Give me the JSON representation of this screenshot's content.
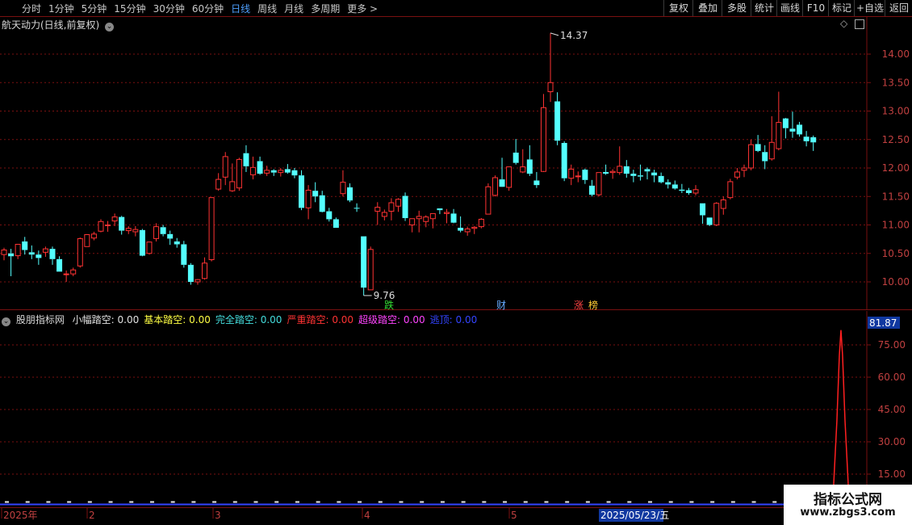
{
  "toolbar": {
    "left_items": [
      "分时",
      "1分钟",
      "5分钟",
      "15分钟",
      "30分钟",
      "60分钟",
      "日线",
      "周线",
      "月线",
      "多周期",
      "更多 >"
    ],
    "active_item": "日线",
    "right_items": [
      "复权",
      "叠加",
      "多股",
      "统计",
      "画线",
      "F10",
      "标记",
      "+自选",
      "返回"
    ]
  },
  "stock_title": "航天动力(日线,前复权)",
  "price_axis": {
    "labels": [
      "14.00",
      "13.50",
      "13.00",
      "12.50",
      "12.00",
      "11.50",
      "11.00",
      "10.50",
      "10.00"
    ]
  },
  "price_markers": {
    "high": "14.37",
    "low": "9.76"
  },
  "event_tags": [
    {
      "text": "跌",
      "color": "#33dd33"
    },
    {
      "text": "财",
      "color": "#66aaff"
    },
    {
      "text": "涨",
      "color": "#ff4444"
    },
    {
      "text": "榜",
      "color": "#ffcc33"
    }
  ],
  "indicator": {
    "name": "股朋指标网",
    "items": [
      {
        "label": "小幅踏空:",
        "value": "0.00",
        "color": "#e0e0e0"
      },
      {
        "label": "基本踏空:",
        "value": "0.00",
        "color": "#ffff44"
      },
      {
        "label": "完全踏空:",
        "value": "0.00",
        "color": "#44dddd"
      },
      {
        "label": "严重踏空:",
        "value": "0.00",
        "color": "#ff3333"
      },
      {
        "label": "超级踏空:",
        "value": "0.00",
        "color": "#ff44ff"
      },
      {
        "label": "逃顶:",
        "value": "0.00",
        "color": "#3344ff"
      }
    ],
    "current_value": "81.87",
    "axis_labels": [
      "75.00",
      "60.00",
      "45.00",
      "30.00",
      "15.00"
    ]
  },
  "date_axis": {
    "labels": [
      "2025年",
      "2",
      "3",
      "4",
      "5"
    ],
    "cursor": "2025/05/23/五"
  },
  "watermark": {
    "line1": "指标公式网",
    "line2": "www.zbgs3.com"
  },
  "colors": {
    "up": "#ff3333",
    "down": "#54ffff",
    "grid": "#7a1010",
    "axis_text": "#c04040"
  },
  "chart_data": {
    "type": "candlestick",
    "price_range": [
      9.5,
      14.6
    ],
    "candles": [
      {
        "o": 10.48,
        "h": 10.6,
        "l": 10.38,
        "c": 10.56
      },
      {
        "o": 10.5,
        "h": 10.58,
        "l": 10.1,
        "c": 10.45
      },
      {
        "o": 10.46,
        "h": 10.66,
        "l": 10.4,
        "c": 10.66
      },
      {
        "o": 10.71,
        "h": 10.79,
        "l": 10.48,
        "c": 10.56
      },
      {
        "o": 10.52,
        "h": 10.64,
        "l": 10.4,
        "c": 10.48
      },
      {
        "o": 10.48,
        "h": 10.55,
        "l": 10.3,
        "c": 10.42
      },
      {
        "o": 10.52,
        "h": 10.62,
        "l": 10.44,
        "c": 10.58
      },
      {
        "o": 10.58,
        "h": 10.62,
        "l": 10.3,
        "c": 10.4
      },
      {
        "o": 10.4,
        "h": 10.45,
        "l": 10.18,
        "c": 10.18
      },
      {
        "o": 10.14,
        "h": 10.2,
        "l": 10.0,
        "c": 10.14
      },
      {
        "o": 10.14,
        "h": 10.25,
        "l": 10.1,
        "c": 10.21
      },
      {
        "o": 10.28,
        "h": 10.78,
        "l": 10.25,
        "c": 10.76
      },
      {
        "o": 10.62,
        "h": 10.84,
        "l": 10.62,
        "c": 10.83
      },
      {
        "o": 10.77,
        "h": 10.88,
        "l": 10.73,
        "c": 10.84
      },
      {
        "o": 10.89,
        "h": 11.1,
        "l": 10.87,
        "c": 11.06
      },
      {
        "o": 11.0,
        "h": 11.07,
        "l": 10.88,
        "c": 11.0
      },
      {
        "o": 11.07,
        "h": 11.2,
        "l": 10.98,
        "c": 11.14
      },
      {
        "o": 11.14,
        "h": 11.16,
        "l": 10.83,
        "c": 10.9
      },
      {
        "o": 10.9,
        "h": 10.98,
        "l": 10.84,
        "c": 10.94
      },
      {
        "o": 10.88,
        "h": 10.98,
        "l": 10.8,
        "c": 10.92
      },
      {
        "o": 10.91,
        "h": 10.93,
        "l": 10.45,
        "c": 10.46
      },
      {
        "o": 10.5,
        "h": 10.7,
        "l": 10.48,
        "c": 10.7
      },
      {
        "o": 10.76,
        "h": 11.03,
        "l": 10.71,
        "c": 10.97
      },
      {
        "o": 10.96,
        "h": 11.0,
        "l": 10.8,
        "c": 10.84
      },
      {
        "o": 10.84,
        "h": 10.9,
        "l": 10.65,
        "c": 10.76
      },
      {
        "o": 10.71,
        "h": 10.77,
        "l": 10.6,
        "c": 10.66
      },
      {
        "o": 10.66,
        "h": 10.72,
        "l": 10.25,
        "c": 10.3
      },
      {
        "o": 10.3,
        "h": 10.33,
        "l": 9.95,
        "c": 10.0
      },
      {
        "o": 10.0,
        "h": 10.05,
        "l": 9.95,
        "c": 10.04
      },
      {
        "o": 10.06,
        "h": 10.43,
        "l": 10.04,
        "c": 10.33
      },
      {
        "o": 10.39,
        "h": 10.7,
        "l": 10.36,
        "c": 11.48
      },
      {
        "o": 11.63,
        "h": 11.91,
        "l": 11.6,
        "c": 11.8
      },
      {
        "o": 11.84,
        "h": 12.28,
        "l": 11.7,
        "c": 12.2
      },
      {
        "o": 11.6,
        "h": 12.08,
        "l": 11.58,
        "c": 11.76
      },
      {
        "o": 11.65,
        "h": 12.18,
        "l": 11.6,
        "c": 12.15
      },
      {
        "o": 12.26,
        "h": 12.4,
        "l": 11.93,
        "c": 12.03
      },
      {
        "o": 11.88,
        "h": 12.2,
        "l": 11.8,
        "c": 12.01
      },
      {
        "o": 12.12,
        "h": 12.2,
        "l": 11.88,
        "c": 11.9
      },
      {
        "o": 11.91,
        "h": 12.04,
        "l": 11.86,
        "c": 11.96
      },
      {
        "o": 11.96,
        "h": 11.98,
        "l": 11.86,
        "c": 11.92
      },
      {
        "o": 11.92,
        "h": 12.0,
        "l": 11.85,
        "c": 11.96
      },
      {
        "o": 11.98,
        "h": 12.07,
        "l": 11.9,
        "c": 11.92
      },
      {
        "o": 11.96,
        "h": 12.0,
        "l": 11.82,
        "c": 11.87
      },
      {
        "o": 11.87,
        "h": 11.96,
        "l": 11.26,
        "c": 11.3
      },
      {
        "o": 11.3,
        "h": 11.7,
        "l": 11.1,
        "c": 11.61
      },
      {
        "o": 11.6,
        "h": 11.75,
        "l": 11.4,
        "c": 11.5
      },
      {
        "o": 11.52,
        "h": 11.6,
        "l": 11.22,
        "c": 11.23
      },
      {
        "o": 11.24,
        "h": 11.3,
        "l": 11.06,
        "c": 11.1
      },
      {
        "o": 11.1,
        "h": 11.13,
        "l": 10.95,
        "c": 10.95
      },
      {
        "o": 11.55,
        "h": 11.96,
        "l": 11.5,
        "c": 11.75
      },
      {
        "o": 11.66,
        "h": 11.73,
        "l": 11.4,
        "c": 11.43
      },
      {
        "o": 11.3,
        "h": 11.38,
        "l": 11.23,
        "c": 11.29
      },
      {
        "o": 10.8,
        "h": 10.8,
        "l": 9.76,
        "c": 9.9
      },
      {
        "o": 9.86,
        "h": 10.62,
        "l": 9.86,
        "c": 10.57
      },
      {
        "o": 11.24,
        "h": 11.4,
        "l": 11.0,
        "c": 11.31
      },
      {
        "o": 11.15,
        "h": 11.27,
        "l": 11.08,
        "c": 11.22
      },
      {
        "o": 11.24,
        "h": 11.47,
        "l": 11.08,
        "c": 11.39
      },
      {
        "o": 11.33,
        "h": 11.47,
        "l": 11.23,
        "c": 11.45
      },
      {
        "o": 11.51,
        "h": 11.57,
        "l": 11.07,
        "c": 11.12
      },
      {
        "o": 11.0,
        "h": 11.05,
        "l": 10.87,
        "c": 11.11
      },
      {
        "o": 11.11,
        "h": 11.25,
        "l": 10.87,
        "c": 11.15
      },
      {
        "o": 11.06,
        "h": 11.17,
        "l": 10.96,
        "c": 11.14
      },
      {
        "o": 11.11,
        "h": 11.2,
        "l": 10.94,
        "c": 11.2
      },
      {
        "o": 11.29,
        "h": 11.28,
        "l": 11.19,
        "c": 11.26
      },
      {
        "o": 11.2,
        "h": 11.28,
        "l": 11.03,
        "c": 11.22
      },
      {
        "o": 11.2,
        "h": 11.28,
        "l": 11.03,
        "c": 11.04
      },
      {
        "o": 10.95,
        "h": 11.15,
        "l": 10.87,
        "c": 10.9
      },
      {
        "o": 10.88,
        "h": 10.97,
        "l": 10.81,
        "c": 10.93
      },
      {
        "o": 10.94,
        "h": 10.98,
        "l": 10.84,
        "c": 10.96
      },
      {
        "o": 10.97,
        "h": 11.12,
        "l": 10.94,
        "c": 11.1
      },
      {
        "o": 11.19,
        "h": 11.73,
        "l": 11.19,
        "c": 11.67
      },
      {
        "o": 11.52,
        "h": 11.87,
        "l": 11.5,
        "c": 11.83
      },
      {
        "o": 11.8,
        "h": 12.18,
        "l": 11.73,
        "c": 11.67
      },
      {
        "o": 11.66,
        "h": 12.0,
        "l": 11.6,
        "c": 12.02
      },
      {
        "o": 12.27,
        "h": 12.51,
        "l": 12.06,
        "c": 12.09
      },
      {
        "o": 11.93,
        "h": 12.33,
        "l": 11.91,
        "c": 12.02
      },
      {
        "o": 12.15,
        "h": 12.4,
        "l": 11.86,
        "c": 11.9
      },
      {
        "o": 11.78,
        "h": 11.93,
        "l": 11.65,
        "c": 11.7
      },
      {
        "o": 11.94,
        "h": 13.3,
        "l": 11.93,
        "c": 13.06
      },
      {
        "o": 13.34,
        "h": 14.37,
        "l": 13.16,
        "c": 13.5
      },
      {
        "o": 13.17,
        "h": 13.33,
        "l": 12.4,
        "c": 12.48
      },
      {
        "o": 12.44,
        "h": 12.47,
        "l": 11.77,
        "c": 11.82
      },
      {
        "o": 11.82,
        "h": 12.06,
        "l": 11.7,
        "c": 11.98
      },
      {
        "o": 11.85,
        "h": 11.94,
        "l": 11.75,
        "c": 11.86
      },
      {
        "o": 11.97,
        "h": 11.99,
        "l": 11.72,
        "c": 11.79
      },
      {
        "o": 11.69,
        "h": 11.79,
        "l": 11.5,
        "c": 11.53
      },
      {
        "o": 11.53,
        "h": 11.9,
        "l": 11.5,
        "c": 11.92
      },
      {
        "o": 11.93,
        "h": 12.06,
        "l": 11.88,
        "c": 11.9
      },
      {
        "o": 11.92,
        "h": 11.98,
        "l": 11.81,
        "c": 11.94
      },
      {
        "o": 11.92,
        "h": 12.38,
        "l": 11.88,
        "c": 12.03
      },
      {
        "o": 12.03,
        "h": 12.14,
        "l": 11.83,
        "c": 11.9
      },
      {
        "o": 11.9,
        "h": 11.97,
        "l": 11.75,
        "c": 11.86
      },
      {
        "o": 11.87,
        "h": 12.06,
        "l": 11.78,
        "c": 11.85
      },
      {
        "o": 11.98,
        "h": 12.01,
        "l": 11.8,
        "c": 11.94
      },
      {
        "o": 11.92,
        "h": 11.97,
        "l": 11.75,
        "c": 11.87
      },
      {
        "o": 11.86,
        "h": 11.92,
        "l": 11.73,
        "c": 11.75
      },
      {
        "o": 11.75,
        "h": 11.8,
        "l": 11.64,
        "c": 11.71
      },
      {
        "o": 11.71,
        "h": 11.78,
        "l": 11.62,
        "c": 11.64
      },
      {
        "o": 11.62,
        "h": 11.72,
        "l": 11.56,
        "c": 11.6
      },
      {
        "o": 11.61,
        "h": 11.65,
        "l": 11.53,
        "c": 11.56
      },
      {
        "o": 11.56,
        "h": 11.7,
        "l": 11.52,
        "c": 11.62
      },
      {
        "o": 11.38,
        "h": 11.38,
        "l": 11.02,
        "c": 11.17
      },
      {
        "o": 11.13,
        "h": 11.13,
        "l": 10.98,
        "c": 11.0
      },
      {
        "o": 11.0,
        "h": 11.4,
        "l": 10.98,
        "c": 11.38
      },
      {
        "o": 11.29,
        "h": 11.5,
        "l": 11.18,
        "c": 11.44
      },
      {
        "o": 11.48,
        "h": 11.81,
        "l": 11.45,
        "c": 11.76
      },
      {
        "o": 11.84,
        "h": 12.0,
        "l": 11.8,
        "c": 11.93
      },
      {
        "o": 11.96,
        "h": 12.06,
        "l": 11.84,
        "c": 12.0
      },
      {
        "o": 12.0,
        "h": 12.5,
        "l": 11.96,
        "c": 12.41
      },
      {
        "o": 12.42,
        "h": 12.58,
        "l": 12.28,
        "c": 12.3
      },
      {
        "o": 12.28,
        "h": 12.4,
        "l": 11.98,
        "c": 12.12
      },
      {
        "o": 12.16,
        "h": 12.91,
        "l": 12.13,
        "c": 12.45
      },
      {
        "o": 12.34,
        "h": 13.34,
        "l": 12.31,
        "c": 12.8
      },
      {
        "o": 12.87,
        "h": 12.88,
        "l": 12.52,
        "c": 12.7
      },
      {
        "o": 12.69,
        "h": 12.99,
        "l": 12.53,
        "c": 12.64
      },
      {
        "o": 12.76,
        "h": 12.81,
        "l": 12.55,
        "c": 12.59
      },
      {
        "o": 12.55,
        "h": 12.65,
        "l": 12.38,
        "c": 12.47
      },
      {
        "o": 12.54,
        "h": 12.57,
        "l": 12.3,
        "c": 12.45
      }
    ],
    "indicator_series": {
      "name": "逃顶",
      "spike_index": 121,
      "spike_value": 81.87,
      "range": [
        0,
        90
      ]
    }
  }
}
